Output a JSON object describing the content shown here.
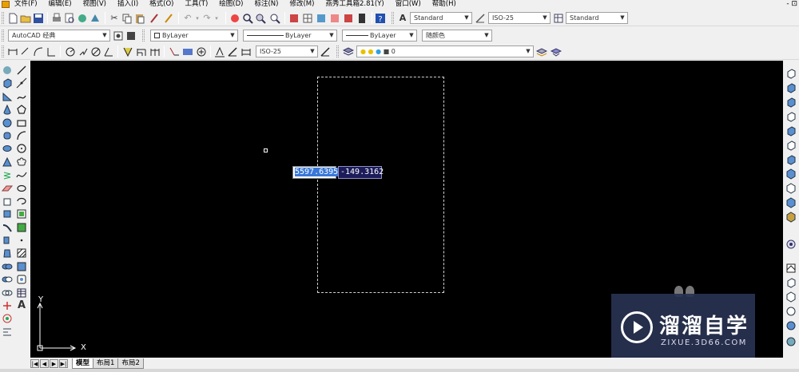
{
  "menu": {
    "items": [
      "文件(F)",
      "编辑(E)",
      "视图(V)",
      "插入(I)",
      "格式(O)",
      "工具(T)",
      "绘图(D)",
      "标注(N)",
      "修改(M)",
      "燕秀工具箱2.81(Y)",
      "窗口(W)",
      "帮助(H)"
    ],
    "window_control": "- ⊡"
  },
  "toolbar2": {
    "text_style": "Standard",
    "dim_style": "ISO-25",
    "table_style": "Standard"
  },
  "toolbar3": {
    "workspace": "AutoCAD 经典",
    "layer_color": "ByLayer",
    "linetype": "ByLayer",
    "lineweight": "ByLayer",
    "plot_style": "随颜色"
  },
  "toolbar4": {
    "dim_style": "ISO-25",
    "layer": "0"
  },
  "canvas": {
    "coord_x": "5597.6395",
    "coord_y": "-149.3162",
    "ucs_y": "Y",
    "ucs_x": "X"
  },
  "tabs": [
    "模型",
    "布局1",
    "布局2"
  ],
  "active_tab": "模型",
  "watermark": {
    "title": "溜溜自学",
    "subtitle": "ZIXUE.3D66.COM"
  },
  "icons": {
    "left_col1": [
      "orbit-icon",
      "box-icon",
      "wedge-icon",
      "cone-icon",
      "sphere-icon",
      "cylinder-icon",
      "torus-icon",
      "pyramid-icon",
      "helix-icon",
      "planar-surface-icon",
      "extrude-icon",
      "presspull-icon",
      "sweep-icon",
      "revolve-icon",
      "loft-icon",
      "union-icon",
      "subtract-icon",
      "intersect-icon",
      "3d-move-icon",
      "3d-rotate-icon",
      "3d-align-icon"
    ],
    "left_col2": [
      "line-icon",
      "construction-line-icon",
      "polyline-icon",
      "polygon-icon",
      "rectangle-icon",
      "arc-icon",
      "circle-icon",
      "revision-cloud-icon",
      "spline-icon",
      "ellipse-icon",
      "ellipse-arc-icon",
      "insert-block-icon",
      "make-block-icon",
      "point-icon",
      "hatch-icon",
      "gradient-icon",
      "region-icon",
      "table-icon",
      "multiline-text-icon"
    ]
  }
}
